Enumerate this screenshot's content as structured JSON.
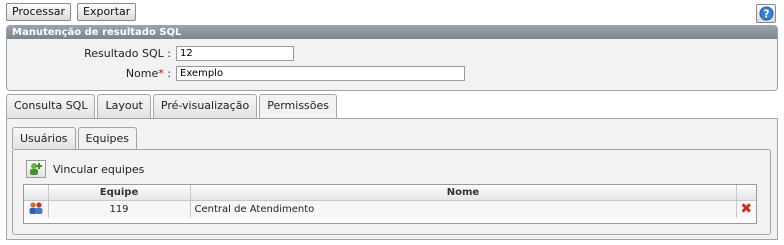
{
  "toolbar": {
    "process_label": "Processar",
    "export_label": "Exportar"
  },
  "help": {
    "icon": "help-icon"
  },
  "panel": {
    "title": "Manutenção de resultado SQL",
    "fields": {
      "result_label": "Resultado SQL :",
      "result_value": "12",
      "name_label": "Nome",
      "name_required_mark": "*",
      "name_colon": ":",
      "name_value": "Exemplo"
    }
  },
  "tabs": [
    {
      "label": "Consulta SQL"
    },
    {
      "label": "Layout"
    },
    {
      "label": "Pré-visualização"
    },
    {
      "label": "Permissões",
      "active": true
    }
  ],
  "subtabs": [
    {
      "label": "Usuários"
    },
    {
      "label": "Equipes",
      "active": true
    }
  ],
  "link_team": {
    "label": "Vincular equipes",
    "icon": "add-team-icon"
  },
  "grid": {
    "columns": [
      "",
      "Equipe",
      "Nome",
      ""
    ],
    "rows": [
      {
        "icon": "team-icon",
        "equipe": "119",
        "nome": "Central de Atendimento",
        "action_icon": "delete-icon"
      }
    ]
  },
  "colors": {
    "panel_header": "#8a939c",
    "delete": "#d12b1f",
    "required": "#d40000"
  }
}
